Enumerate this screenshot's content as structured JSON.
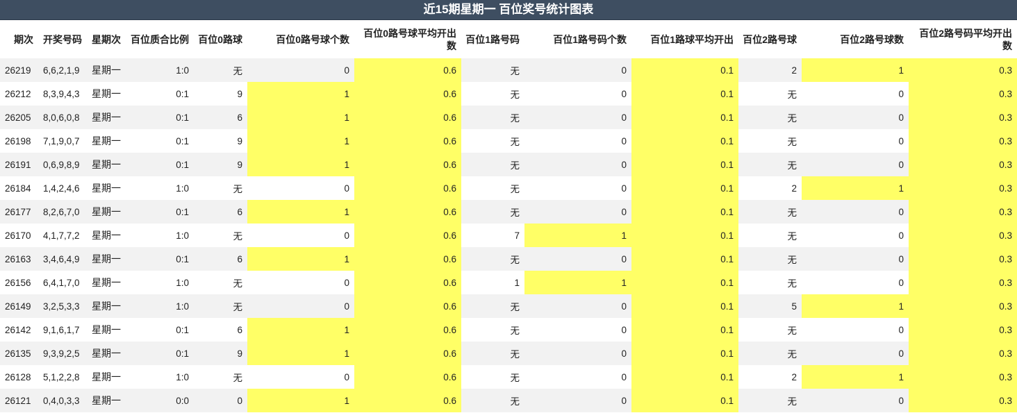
{
  "title": "近15期星期一 百位奖号统计图表",
  "columns": [
    "期次",
    "开奖号码",
    "星期次",
    "百位质合比例",
    "百位0路球",
    "百位0路号球个数",
    "百位0路号球平均开出数",
    "百位1路号码",
    "百位1路号码个数",
    "百位1路球平均开出",
    "百位2路号球",
    "百位2路号球数",
    "百位2路号码平均开出数"
  ],
  "highlight_color": "#ffff66",
  "rows": [
    [
      "26219",
      "6,6,2,1,9",
      "星期一",
      "1:0",
      "无",
      "0",
      "0.6",
      "无",
      "0",
      "0.1",
      "2",
      "1",
      "0.3"
    ],
    [
      "26212",
      "8,3,9,4,3",
      "星期一",
      "0:1",
      "9",
      "1",
      "0.6",
      "无",
      "0",
      "0.1",
      "无",
      "0",
      "0.3"
    ],
    [
      "26205",
      "8,0,6,0,8",
      "星期一",
      "0:1",
      "6",
      "1",
      "0.6",
      "无",
      "0",
      "0.1",
      "无",
      "0",
      "0.3"
    ],
    [
      "26198",
      "7,1,9,0,7",
      "星期一",
      "0:1",
      "9",
      "1",
      "0.6",
      "无",
      "0",
      "0.1",
      "无",
      "0",
      "0.3"
    ],
    [
      "26191",
      "0,6,9,8,9",
      "星期一",
      "0:1",
      "9",
      "1",
      "0.6",
      "无",
      "0",
      "0.1",
      "无",
      "0",
      "0.3"
    ],
    [
      "26184",
      "1,4,2,4,6",
      "星期一",
      "1:0",
      "无",
      "0",
      "0.6",
      "无",
      "0",
      "0.1",
      "2",
      "1",
      "0.3"
    ],
    [
      "26177",
      "8,2,6,7,0",
      "星期一",
      "0:1",
      "6",
      "1",
      "0.6",
      "无",
      "0",
      "0.1",
      "无",
      "0",
      "0.3"
    ],
    [
      "26170",
      "4,1,7,7,2",
      "星期一",
      "1:0",
      "无",
      "0",
      "0.6",
      "7",
      "1",
      "0.1",
      "无",
      "0",
      "0.3"
    ],
    [
      "26163",
      "3,4,6,4,9",
      "星期一",
      "0:1",
      "6",
      "1",
      "0.6",
      "无",
      "0",
      "0.1",
      "无",
      "0",
      "0.3"
    ],
    [
      "26156",
      "6,4,1,7,0",
      "星期一",
      "1:0",
      "无",
      "0",
      "0.6",
      "1",
      "1",
      "0.1",
      "无",
      "0",
      "0.3"
    ],
    [
      "26149",
      "3,2,5,3,3",
      "星期一",
      "1:0",
      "无",
      "0",
      "0.6",
      "无",
      "0",
      "0.1",
      "5",
      "1",
      "0.3"
    ],
    [
      "26142",
      "9,1,6,1,7",
      "星期一",
      "0:1",
      "6",
      "1",
      "0.6",
      "无",
      "0",
      "0.1",
      "无",
      "0",
      "0.3"
    ],
    [
      "26135",
      "9,3,9,2,5",
      "星期一",
      "0:1",
      "9",
      "1",
      "0.6",
      "无",
      "0",
      "0.1",
      "无",
      "0",
      "0.3"
    ],
    [
      "26128",
      "5,1,2,2,8",
      "星期一",
      "1:0",
      "无",
      "0",
      "0.6",
      "无",
      "0",
      "0.1",
      "2",
      "1",
      "0.3"
    ],
    [
      "26121",
      "0,4,0,3,3",
      "星期一",
      "0:0",
      "0",
      "1",
      "0.6",
      "无",
      "0",
      "0.1",
      "无",
      "0",
      "0.3"
    ]
  ]
}
